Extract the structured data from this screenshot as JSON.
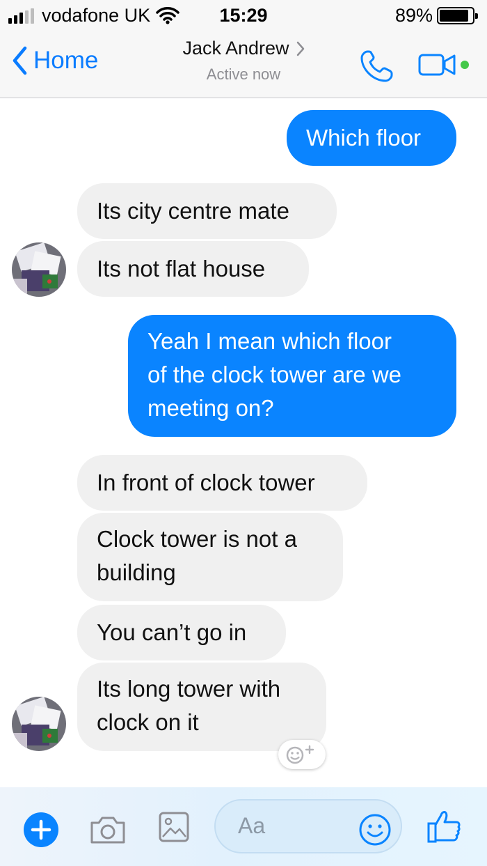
{
  "status_bar": {
    "carrier": "vodafone UK",
    "time": "15:29",
    "battery_percent": "89%",
    "battery_level": 0.89,
    "signal_bars_active": 3,
    "signal_bars_total": 5
  },
  "header": {
    "back_label": "Home",
    "contact_name": "Jack Andrew",
    "contact_status": "Active now",
    "call_icon": "phone-icon",
    "video_icon": "video-camera-icon"
  },
  "messages": [
    {
      "sender": "me",
      "text": "Which floor"
    },
    {
      "sender": "contact",
      "text": "Its city centre mate"
    },
    {
      "sender": "contact",
      "text": "Its not flat house"
    },
    {
      "sender": "me",
      "lines": [
        "Yeah I mean which floor",
        "of the clock tower are we",
        "meeting on?"
      ]
    },
    {
      "sender": "contact",
      "text": "In front of clock tower"
    },
    {
      "sender": "contact",
      "lines": [
        "Clock tower is not a",
        "building"
      ]
    },
    {
      "sender": "contact",
      "text": "You can’t go in"
    },
    {
      "sender": "contact",
      "lines": [
        "Its long tower with",
        "clock on it"
      ]
    }
  ],
  "composer": {
    "placeholder": "Aa",
    "icons": [
      "plus-icon",
      "camera-icon",
      "image-icon",
      "emoji-icon",
      "thumbs-up-icon"
    ]
  },
  "colors": {
    "accent": "#0a84ff",
    "incoming_bubble": "#f0f0f0",
    "outgoing_text": "#ffffff",
    "active_dot": "#44c84a"
  }
}
